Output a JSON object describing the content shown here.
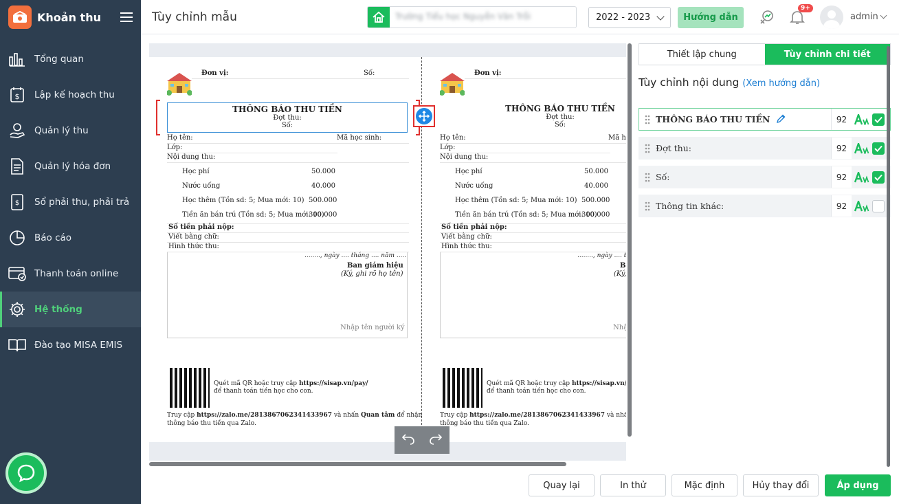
{
  "app": {
    "brand": "Khoản thu"
  },
  "sidebar": {
    "items": [
      {
        "label": "Tổng quan",
        "icon": "chart-bars-icon"
      },
      {
        "label": "Lập kế hoạch thu",
        "icon": "dollar-doc-icon"
      },
      {
        "label": "Quản lý thu",
        "icon": "hand-coin-icon"
      },
      {
        "label": "Quản lý hóa đơn",
        "icon": "invoice-icon"
      },
      {
        "label": "Sổ phải thu, phải trả",
        "icon": "ledger-icon"
      },
      {
        "label": "Báo cáo",
        "icon": "pie-chart-icon"
      },
      {
        "label": "Thanh toán online",
        "icon": "online-payment-icon"
      },
      {
        "label": "Hệ thống",
        "icon": "gear-icon",
        "active": true
      },
      {
        "label": "Đào tạo MISA EMIS",
        "icon": "open-book-icon"
      }
    ]
  },
  "header": {
    "title": "Tùy chỉnh mẫu",
    "school_name": "Trường Tiểu học Nguyễn Văn Trỗi",
    "year": "2022 - 2023",
    "guide_label": "Hướng dẫn",
    "notification_badge": "9+",
    "user": "admin"
  },
  "receipt": {
    "unit_label": "Đơn vị:",
    "number_label": "Số:",
    "title": "THÔNG BÁO THU TIỀN",
    "period_label": "Đợt thu:",
    "no_label": "Số:",
    "name_label": "Họ tên:",
    "student_code_label": "Mã học sinh:",
    "class_label": "Lớp:",
    "content_label": "Nội dung thu:",
    "fees": [
      {
        "name": "Học phí",
        "amount": "50.000"
      },
      {
        "name": "Nước uống",
        "amount": "40.000"
      },
      {
        "name": "Học thêm (Tồn sd: 5; Mua mới: 10)",
        "amount": "500.000"
      },
      {
        "name": "Tiền ăn bán trú (Tồn sd: 5; Mua mới: 10)",
        "amount": "300.000"
      }
    ],
    "amount_due_label": "Số tiền phải nộp:",
    "in_words_label": "Viết bằng chữ:",
    "method_label": "Hình thức thu:",
    "date_line": "........, ngày .... tháng .... năm .....",
    "signer_title": "Ban giám hiệu",
    "signer_note": "(Ký, ghi rõ họ tên)",
    "signer_placeholder": "Nhập tên người ký",
    "qr_text_1": "Quét mã QR hoặc truy cập",
    "qr_url": "https://sisap.vn/pay/",
    "qr_text_2": "để thanh toán tiền học cho con.",
    "zalo_text_1": "Truy cập",
    "zalo_url": "https://zalo.me/2813867062341433967",
    "zalo_text_2": "và nhấn",
    "zalo_follow": "Quan tâm",
    "zalo_text_3": "để nhận",
    "zalo_text_4": "thông báo thu tiền qua Zalo."
  },
  "panel": {
    "tab_general": "Thiết lập chung",
    "tab_detail": "Tùy chỉnh chi tiết",
    "heading": "Tùy chỉnh nội dung",
    "guide_link": "(Xem hướng dẫn)",
    "items": [
      {
        "label": "THÔNG BÁO THU TIỀN",
        "size": "92",
        "checked": true
      },
      {
        "label": "Đợt thu:",
        "size": "92",
        "checked": true
      },
      {
        "label": "Số:",
        "size": "92",
        "checked": true
      },
      {
        "label": "Thông tin khác:",
        "size": "92",
        "checked": false
      }
    ]
  },
  "footer": {
    "back": "Quay lại",
    "print_test": "In thử",
    "default": "Mặc định",
    "cancel": "Hủy thay đổi",
    "apply": "Áp dụng"
  },
  "colors": {
    "primary": "#1bbc5c",
    "sidebar": "#2d3e50",
    "selection": "#3a8fd6",
    "highlight": "#e0302e"
  }
}
